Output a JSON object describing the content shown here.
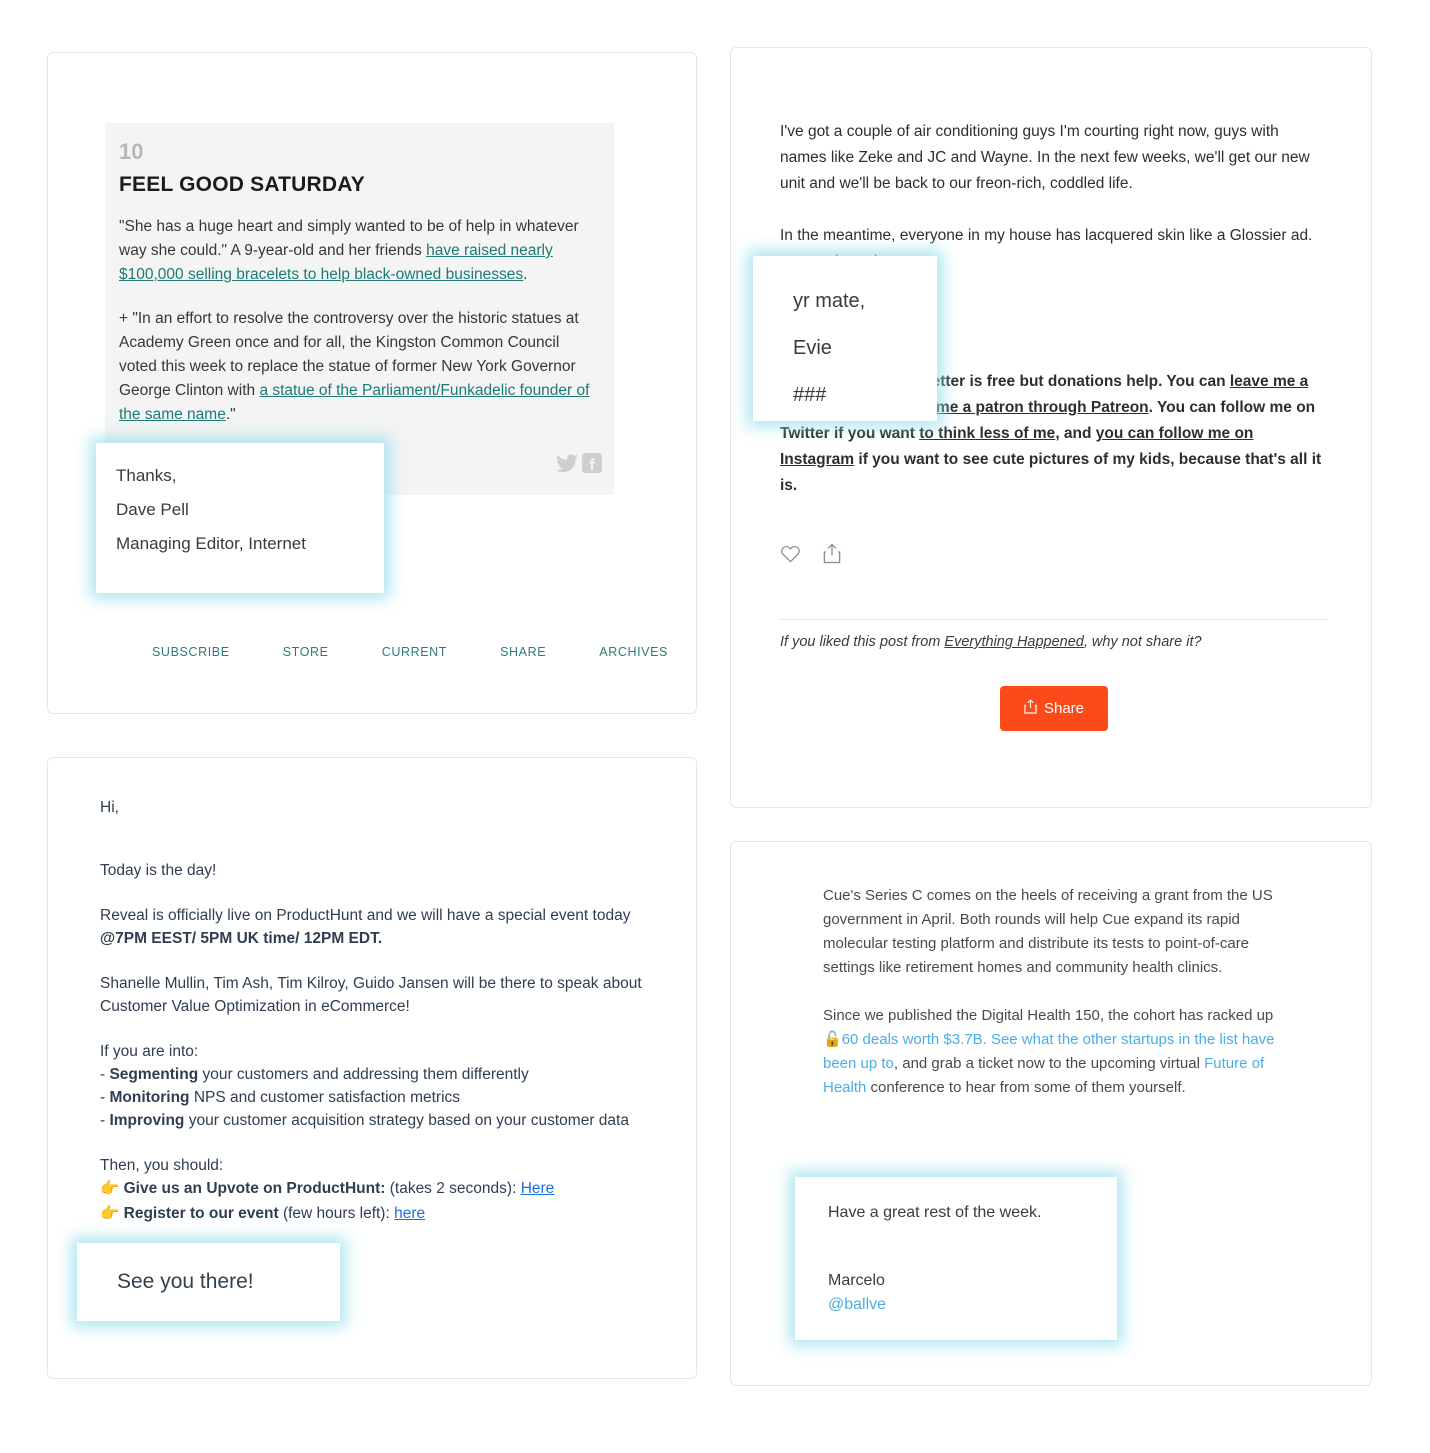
{
  "card_newsletter_nextdraft": {
    "item_number": "10",
    "title": "FEEL GOOD SATURDAY",
    "paragraph1_pre": "\"She has a huge heart and simply wanted to be of help in whatever way she could.\" A 9-year-old and her friends ",
    "paragraph1_link": "have raised nearly $100,000 selling bracelets to help black-owned businesses",
    "paragraph1_post": ".",
    "paragraph2_pre": "+ \"In an effort to resolve the controversy over the historic statues at Academy Green once and for all, the Kingston Common Council voted this week to replace the statue of former New York Governor George Clinton with ",
    "paragraph2_link": "a statue of the Parliament/Funkadelic founder of the same name",
    "paragraph2_post": ".\"",
    "social_icons": [
      "twitter-icon",
      "facebook-icon"
    ],
    "footer_links": [
      "SUBSCRIBE",
      "STORE",
      "CURRENT",
      "SHARE",
      "ARCHIVES"
    ],
    "signoff_callout": {
      "line1": "Thanks,",
      "line2": "",
      "line3": "Dave Pell",
      "line4": "Managing Editor, Internet"
    }
  },
  "card_newsletter_everything_happened": {
    "paragraph1": "I've got a couple of air conditioning guys I'm courting right now, guys with names like Zeke and JC and Wayne. In the next few weeks, we'll get our new unit and we'll be back to our freon-rich, coddled life.",
    "paragraph2_pre": "In the meantime, everyone in my house has lacquered skin like a Glossier ad.",
    "paragraph2_tail": "s never been better.",
    "paragraph3_segments": [
      {
        "text": "Like NPR, this newsletter is free but donations help. You can ",
        "link": false
      },
      {
        "text": "leave me a cash tip here",
        "link": true
      },
      {
        "text": " or ",
        "link": false
      },
      {
        "text": "become a patron through Patreon",
        "link": true
      },
      {
        "text": ". You can follow me on Twitter if you want ",
        "link": false
      },
      {
        "text": "to think less of me",
        "link": true
      },
      {
        "text": ", and ",
        "link": false
      },
      {
        "text": "you can follow me on Instagram",
        "link": true
      },
      {
        "text": " if you want to see cute pictures of my kids, because that's all it is.",
        "link": false
      }
    ],
    "action_icons": [
      "heart-icon",
      "share-upload-icon"
    ],
    "share_prompt_pre": "If you liked this post from ",
    "share_prompt_publication": "Everything Happened",
    "share_prompt_post": ", why not share it?",
    "share_button_label": "Share",
    "share_button_color": "#FC4A1A",
    "signoff_callout": {
      "line1": "yr mate,",
      "line2": "Evie",
      "line3": "###"
    }
  },
  "card_newsletter_reveal": {
    "greeting": "Hi,",
    "line_today": "Today is the day!",
    "para_live_pre": "Reveal is officially live on ProductHunt and we will have a special event today ",
    "para_live_bold": "@7PM EEST/ 5PM UK time/ 12PM EDT.",
    "para_speakers": "Shanelle Mullin, Tim Ash, Tim Kilroy, Guido Jansen will be there to speak about Customer Value Optimization in eCommerce!",
    "if_you_are_into": "If you are into:",
    "bullets": [
      {
        "dash": "- ",
        "bold": "Segmenting",
        "rest": " your customers and addressing them differently"
      },
      {
        "dash": "- ",
        "bold": "Monitoring",
        "rest": " NPS and customer satisfaction metrics"
      },
      {
        "dash": "- ",
        "bold": "Improving",
        "rest": " your customer acquisition strategy based on your customer data"
      }
    ],
    "then_you_should": "Then, you should:",
    "cta1_icon": "pointing-hand-icon",
    "cta1_bold": "Give us an Upvote on ProductHunt:",
    "cta1_rest": " (takes 2 seconds): ",
    "cta1_link": "Here",
    "cta2_icon": "pointing-hand-icon",
    "cta2_bold": "Register to our event",
    "cta2_rest": " (few hours left): ",
    "cta2_link": "here",
    "signoff_callout": {
      "line1": "See you there!"
    }
  },
  "card_newsletter_cbinsights": {
    "paragraph1": "Cue's Series C comes on the heels of receiving a grant from the US government in April. Both rounds will help Cue expand its rapid molecular testing platform and distribute its tests to point-of-care settings like retirement homes and community health clinics.",
    "paragraph2_pre": "Since we published the Digital Health 150, the cohort has racked up ",
    "paragraph2_icon": "unlock-icon",
    "paragraph2_link1": "60 deals worth $3.7B. See what the other startups in the list have been up to",
    "paragraph2_mid": ", and grab a ticket now to the upcoming virtual ",
    "paragraph2_link2": "Future of Health",
    "paragraph2_post": " conference to hear from some of them yourself.",
    "signoff_callout": {
      "line1": "Have a great rest of the week.",
      "line2": "Marcelo",
      "line3": "@ballve"
    }
  },
  "theme": {
    "callout_glow": "#96deee",
    "card_border": "#e6e6e6",
    "nextdraft_link": "#1d7a74",
    "reveal_text": "#2f3e50",
    "cb_link": "#4aaee8"
  }
}
